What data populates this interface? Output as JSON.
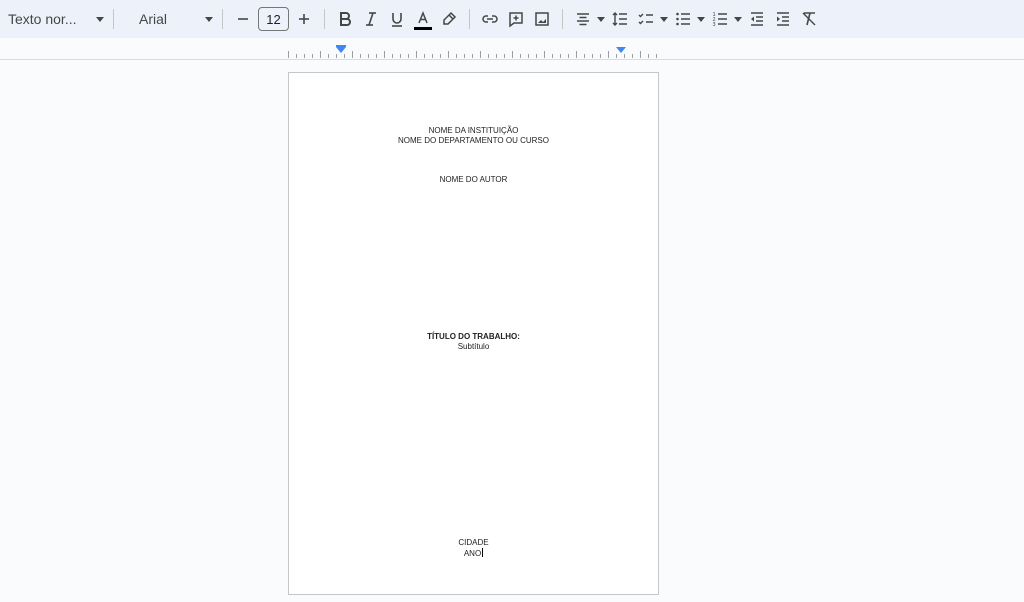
{
  "toolbar": {
    "style_label": "Texto nor...",
    "font_label": "Arial",
    "font_size": "12"
  },
  "icons": {
    "decrease": "minus-icon",
    "increase": "plus-icon",
    "bold": "bold-icon",
    "italic": "italic-icon",
    "underline": "underline-icon",
    "text_color": "text-color-icon",
    "highlight": "highlighter-icon",
    "link": "link-icon",
    "comment": "add-comment-icon",
    "image": "insert-image-icon",
    "align": "align-center-icon",
    "line_spacing": "line-spacing-icon",
    "checklist": "checklist-icon",
    "bullets": "bulleted-list-icon",
    "numbered": "numbered-list-icon",
    "outdent": "decrease-indent-icon",
    "indent": "increase-indent-icon",
    "clear": "clear-formatting-icon"
  },
  "colors": {
    "toolbar_bg": "#edf2fa",
    "ruler_marker": "#4285f4",
    "text_color_bar": "#000000"
  },
  "document": {
    "institution": "NOME DA INSTITUIÇÃO",
    "department": "NOME DO DEPARTAMENTO OU CURSO",
    "author": "NOME DO AUTOR",
    "title": "TÍTULO DO TRABALHO:",
    "subtitle": "Subtítulo",
    "city": "CIDADE",
    "year": "ANO"
  }
}
